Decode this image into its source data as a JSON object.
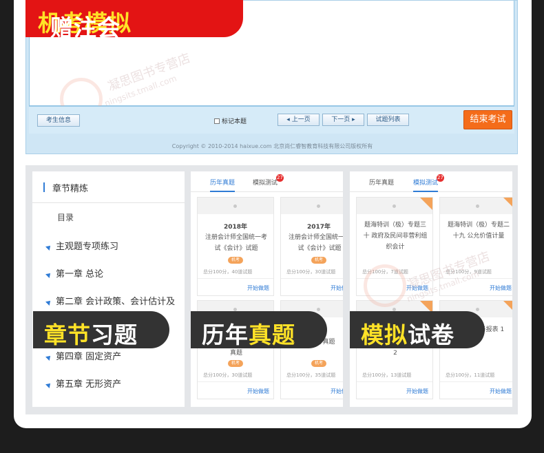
{
  "banner": {
    "pre": "赠注会",
    "highlight": "机考模拟"
  },
  "exam": {
    "candidate_info_label": "考生信息",
    "mark_label": "标记本题",
    "prev_label": "上一页",
    "next_label": "下一页",
    "list_label": "试题列表",
    "end_label": "结束考试",
    "copyright": "Copyright © 2010-2014 haixue.com 北京尚仁睿智教育科技有限公司版权所有"
  },
  "watermark": {
    "shop_cn": "凝思图书专营店",
    "shop_url": "ningsits.tmall.com"
  },
  "chapters": {
    "title": "章节精炼",
    "catalog": "目录",
    "items": [
      "主观题专项练习",
      "第一章  总论",
      "第二章  会计政策、会计估计及",
      "第四章  固定资产",
      "第五章  无形资产"
    ]
  },
  "history": {
    "tabs": [
      "历年真题",
      "模拟测试"
    ],
    "badge": "27",
    "cards": [
      {
        "year": "2018年",
        "name": "注册会计师全国统一考试《会计》试题",
        "tag": "机考",
        "meta": "总分100分，40道试题",
        "go": "开始做题"
      },
      {
        "year": "2017年",
        "name": "注册会计师全国统一考试《会计》试题",
        "tag": "机考",
        "meta": "总分100分，30道试题",
        "go": "开始做题"
      },
      {
        "name": "真题",
        "tag": "机考",
        "meta": "总分100分，30道试题",
        "go": "开始做题"
      },
      {
        "name": "《会计真题",
        "tag": "机考",
        "meta": "总分100分，35道试题",
        "go": "开始做题"
      }
    ]
  },
  "mock": {
    "tabs": [
      "历年真题",
      "模拟测试"
    ],
    "badge": "27",
    "cards": [
      {
        "name": "题海特训（极）专题三十 政府及民间非营利组织会计",
        "meta": "总分100分，7道试题",
        "go": "开始做题"
      },
      {
        "name": "题海特训（极）专题二十九 公允价值计量",
        "meta": "总分100分，9道试题",
        "go": "开始做题"
      },
      {
        "name": "2",
        "meta": "总分100分，13道试题",
        "go": "开始做题"
      },
      {
        "name": "）专题 财务报表 1",
        "meta": "总分100分，11道试题",
        "go": "开始做题"
      }
    ]
  },
  "labels": {
    "chapter": {
      "pre": "章节",
      "post": "习题"
    },
    "history": {
      "pre": "历年",
      "post": "真题"
    },
    "mock": {
      "pre": "模拟",
      "post": "试卷"
    }
  }
}
